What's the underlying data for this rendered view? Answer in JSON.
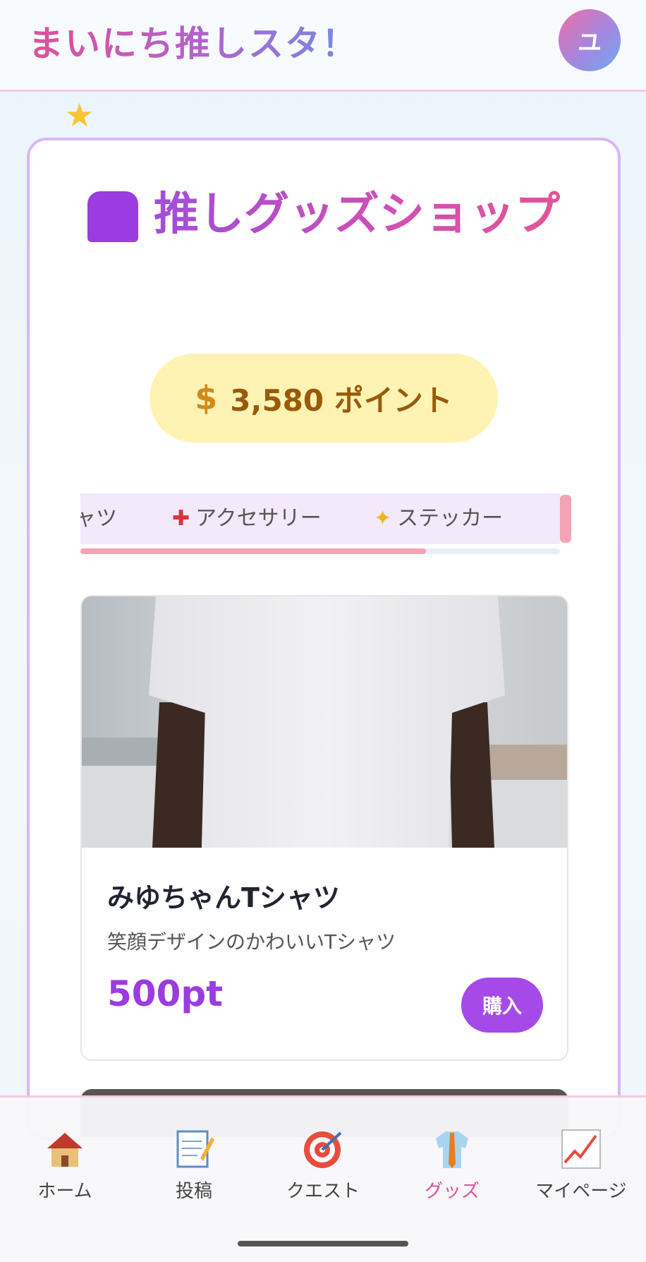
{
  "header": {
    "app_title": "まいにち推しスタ！",
    "avatar_initial": "ユ"
  },
  "shop": {
    "title": "推しグッズショップ",
    "points_label": "3,580 ポイント",
    "points_value": 3580
  },
  "categories": {
    "tabs": [
      {
        "label": "ャツ",
        "icon": ""
      },
      {
        "label": "アクセサリー",
        "icon": "pushpin-icon"
      },
      {
        "label": "ステッカー",
        "icon": "sparkles-icon"
      }
    ],
    "scroll_progress": 0.72
  },
  "product": {
    "name": "みゆちゃんTシャツ",
    "description": "笑顔デザインのかわいいTシャツ",
    "price": "500pt",
    "buy_label": "購入"
  },
  "bottom_nav": {
    "items": [
      {
        "label": "ホーム",
        "icon": "house-icon"
      },
      {
        "label": "投稿",
        "icon": "memo-icon"
      },
      {
        "label": "クエスト",
        "icon": "target-icon"
      },
      {
        "label": "グッズ",
        "icon": "shirt-icon",
        "active": true
      },
      {
        "label": "マイページ",
        "icon": "chart-icon"
      }
    ]
  },
  "colors": {
    "accent_pink": "#e0509a",
    "accent_purple": "#9b3ce0",
    "points_bg": "#fff3b3",
    "card_border": "#d9b6f2"
  }
}
